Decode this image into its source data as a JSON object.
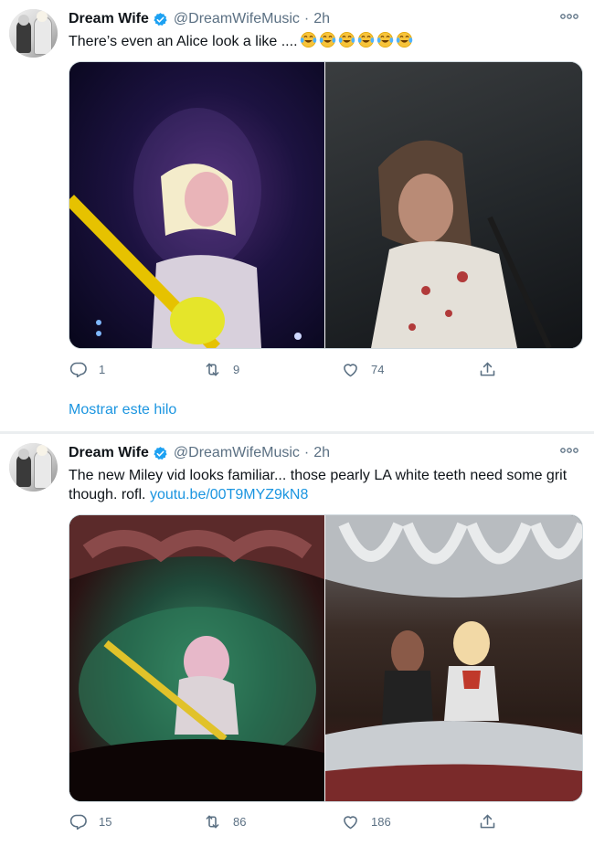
{
  "tweets": [
    {
      "author": "Dream Wife",
      "handle": "@DreamWifeMusic",
      "separator": "·",
      "time": "2h",
      "text": "There’s even an Alice look a like ....",
      "emojis": [
        "tears-of-joy",
        "tears-of-joy",
        "tears-of-joy",
        "tears-of-joy",
        "tears-of-joy",
        "tears-of-joy"
      ],
      "link": "",
      "replies": "1",
      "retweets": "9",
      "likes": "74",
      "show_thread": "Mostrar este hilo"
    },
    {
      "author": "Dream Wife",
      "handle": "@DreamWifeMusic",
      "separator": "·",
      "time": "2h",
      "text": "The new Miley vid looks familiar... those pearly LA white teeth need some grit though. rofl. ",
      "link": "youtu.be/00T9MYZ9kN8",
      "replies": "15",
      "retweets": "86",
      "likes": "186"
    }
  ],
  "colors": {
    "link": "#1b95e0",
    "muted": "#5b7083",
    "verified": "#1da1f2",
    "divider": "#ebeef0"
  }
}
